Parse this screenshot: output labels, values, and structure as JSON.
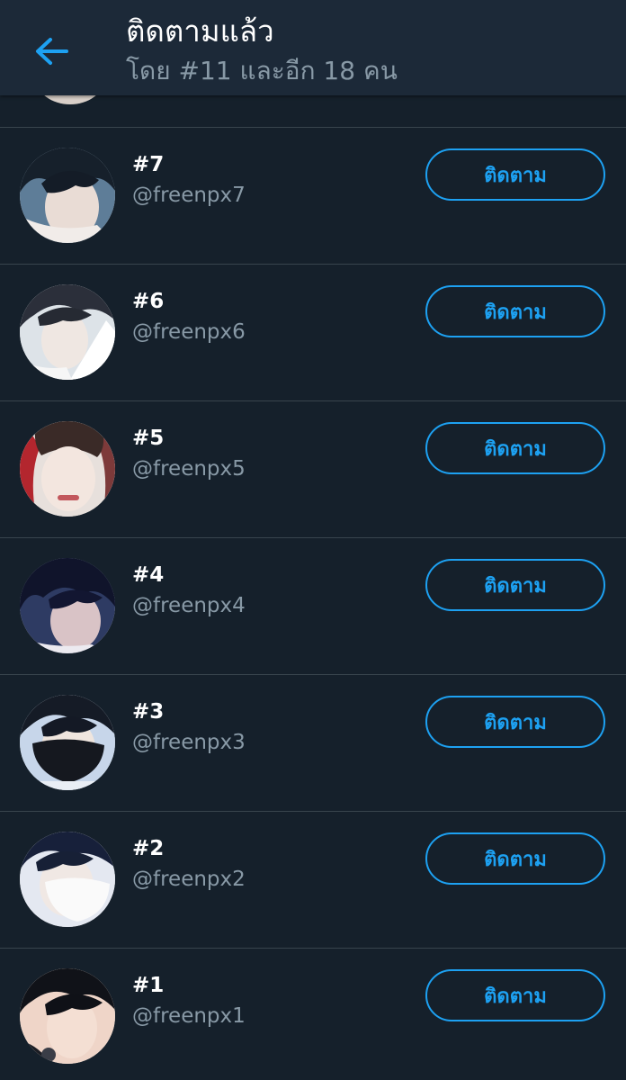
{
  "header": {
    "title": "ติดตามแล้ว",
    "subtitle": "โดย #11 และอีก 18 คน",
    "back_icon": "arrow-left-icon"
  },
  "colors": {
    "background": "#15202b",
    "header_background": "#1c2938",
    "accent": "#1da1f2",
    "secondary_text": "#8899a6",
    "divider": "#38444d"
  },
  "users": [
    {
      "name": "#7",
      "handle": "@freenpx7",
      "button_label": "ติดตาม"
    },
    {
      "name": "#6",
      "handle": "@freenpx6",
      "button_label": "ติดตาม"
    },
    {
      "name": "#5",
      "handle": "@freenpx5",
      "button_label": "ติดตาม"
    },
    {
      "name": "#4",
      "handle": "@freenpx4",
      "button_label": "ติดตาม"
    },
    {
      "name": "#3",
      "handle": "@freenpx3",
      "button_label": "ติดตาม"
    },
    {
      "name": "#2",
      "handle": "@freenpx2",
      "button_label": "ติดตาม"
    },
    {
      "name": "#1",
      "handle": "@freenpx1",
      "button_label": "ติดตาม"
    }
  ]
}
